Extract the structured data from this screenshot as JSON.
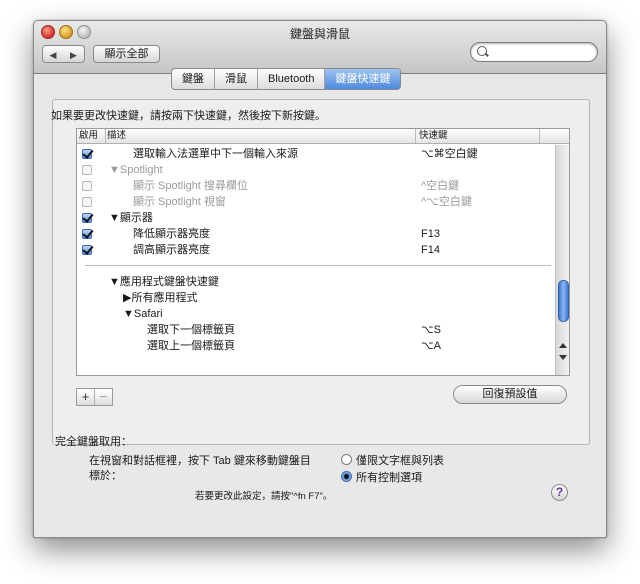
{
  "window": {
    "title": "鍵盤與滑鼠"
  },
  "toolbar": {
    "back": "◀",
    "forward": "▶",
    "show_all": "顯示全部",
    "search_placeholder": ""
  },
  "tabs": [
    {
      "label": "鍵盤",
      "active": false
    },
    {
      "label": "滑鼠",
      "active": false
    },
    {
      "label": "Bluetooth",
      "active": false
    },
    {
      "label": "鍵盤快速鍵",
      "active": true
    }
  ],
  "instruction": "如果要更改快速鍵，請按兩下快速鍵，然後按下新按鍵。",
  "table": {
    "headers": {
      "enabled": "啟用",
      "description": "描述",
      "shortcut": "快速鍵"
    },
    "rows": [
      {
        "checked": true,
        "dim": false,
        "label": "選取輸入法選單中下一個輸入來源",
        "shortcut": "⌥⌘空白鍵"
      },
      {
        "checked": false,
        "dim": true,
        "label": "▼Spotlight",
        "shortcut": ""
      },
      {
        "checked": false,
        "dim": true,
        "label": "顯示 Spotlight 搜尋欄位",
        "shortcut": "^空白鍵"
      },
      {
        "checked": false,
        "dim": true,
        "label": "顯示 Spotlight 視窗",
        "shortcut": "^⌥空白鍵"
      },
      {
        "checked": true,
        "dim": false,
        "label": "▼顯示器",
        "shortcut": ""
      },
      {
        "checked": true,
        "dim": false,
        "label": "降低顯示器亮度",
        "shortcut": "F13"
      },
      {
        "checked": true,
        "dim": false,
        "label": "調高顯示器亮度",
        "shortcut": "F14"
      }
    ],
    "app_rows": [
      {
        "label": "▼應用程式鍵盤快速鍵",
        "shortcut": ""
      },
      {
        "label": "▶所有應用程式",
        "shortcut": ""
      },
      {
        "label": "▼Safari",
        "shortcut": ""
      },
      {
        "label": "選取下一個標籤頁",
        "shortcut": "⌥S"
      },
      {
        "label": "選取上一個標籤頁",
        "shortcut": "⌥A"
      }
    ]
  },
  "buttons": {
    "add": "+",
    "remove": "−",
    "restore_defaults": "回復預設值"
  },
  "full_keyboard": {
    "title": "完全鍵盤取用：",
    "desc_line1": "在視窗和對話框裡，按下 Tab 鍵來移動鍵盤目",
    "desc_line2": "標於：",
    "option1": "僅限文字框與列表",
    "option2": "所有控制選項",
    "selected": "所有控制選項",
    "hint": "若要更改此設定，請按\"^fn F7\"。"
  },
  "help": "?"
}
